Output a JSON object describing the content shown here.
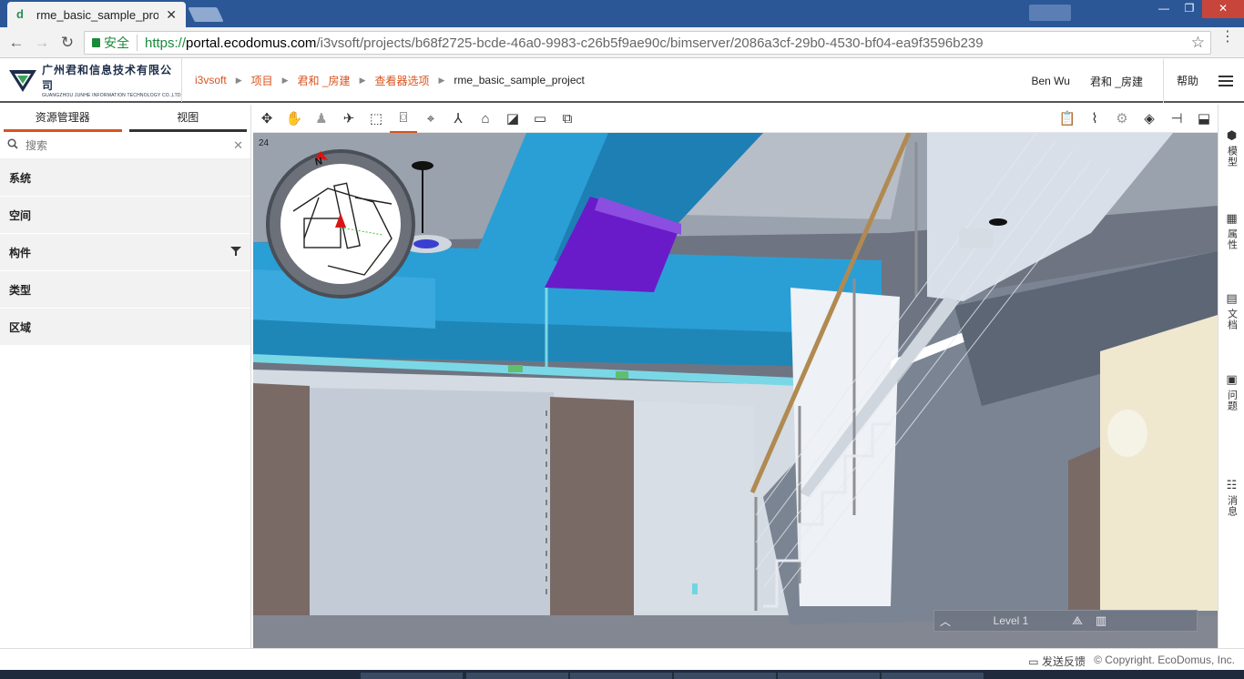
{
  "browser": {
    "tab_title": "rme_basic_sample_proj",
    "secure_label": "安全",
    "url_scheme": "https://",
    "url_host": "portal.ecodomus.com",
    "url_path": "/i3vsoft/projects/b68f2725-bcde-46a0-9983-c26b5f9ae90c/bimserver/2086a3cf-29b0-4530-bf04-ea9f3596b239"
  },
  "header": {
    "logo_cn": "广州君和信息技术有限公司",
    "logo_en": "GUANGZHOU JUNHE INFORMATION TECHNOLOGY CO.,LTD",
    "breadcrumbs": [
      "i3vsoft",
      "项目",
      "君和 _房建",
      "查看器选项",
      "rme_basic_sample_project"
    ],
    "user": "Ben Wu",
    "org": "君和 _房建",
    "help": "帮助"
  },
  "left_panel": {
    "tabs": [
      "资源管理器",
      "视图"
    ],
    "search_placeholder": "搜索",
    "items": [
      "系统",
      "空间",
      "构件",
      "类型",
      "区域"
    ]
  },
  "viewport": {
    "frame_counter": "24",
    "level_label": "Level 1",
    "compass_north": "N"
  },
  "right_rail": {
    "items": [
      "模型",
      "属性",
      "文档",
      "问题",
      "消息"
    ]
  },
  "footer": {
    "feedback": "发送反馈",
    "copyright": "© Copyright. EcoDomus, Inc."
  },
  "colors": {
    "accent": "#d9531e",
    "duct_blue": "#2a9fd6",
    "purple_box": "#6a1bc9",
    "chrome_blue": "#2b5797"
  },
  "icons": [
    "pan-icon",
    "orbit-icon",
    "walk-icon",
    "fly-icon",
    "section-box-icon",
    "section-plane-icon",
    "focus-icon",
    "axes-icon",
    "home-icon",
    "add-note-icon",
    "measure-icon",
    "clash-icon",
    "report-icon",
    "chart-icon",
    "settings-icon",
    "layers-icon",
    "slider-icon",
    "fullscreen-icon"
  ]
}
